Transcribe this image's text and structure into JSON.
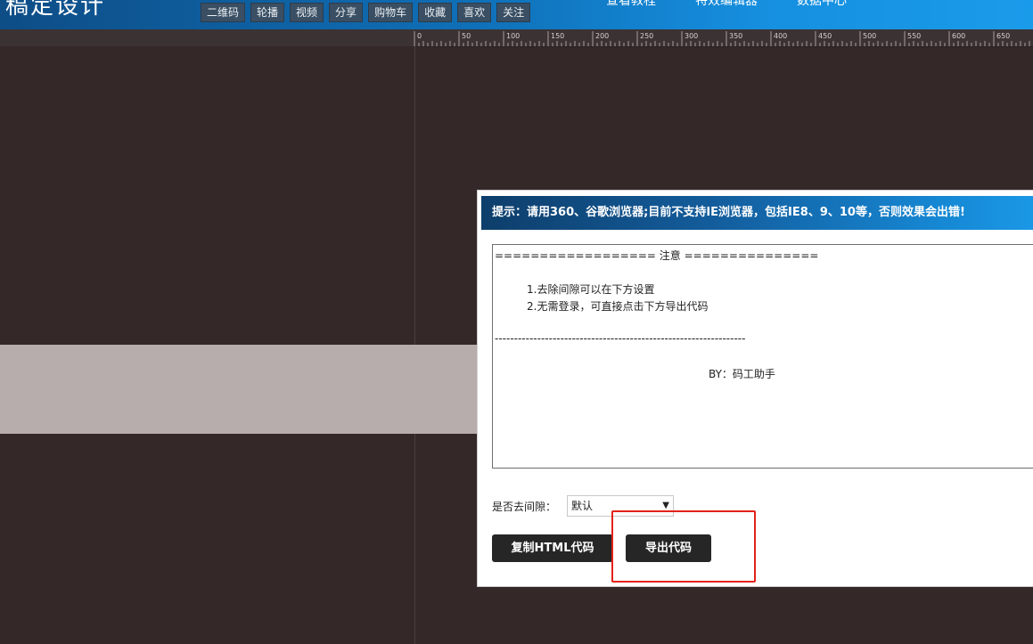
{
  "header": {
    "logo_text": "稿定设计",
    "toolbar": [
      "二维码",
      "轮播",
      "视频",
      "分享",
      "购物车",
      "收藏",
      "喜欢",
      "关注"
    ],
    "nav": [
      "查看教程",
      "特效编辑器",
      "数据中心"
    ]
  },
  "ruler": {
    "labels": [
      "0",
      "50",
      "100",
      "150",
      "200",
      "250",
      "300",
      "350",
      "400",
      "450",
      "500",
      "550",
      "600",
      "650"
    ]
  },
  "dialog": {
    "tip": "提示：请用360、谷歌浏览器;目前不支持IE浏览器，包括IE8、9、10等，否则效果会出错!",
    "notice": {
      "header": "==================  注意  ===============",
      "line1": "1.去除间隙可以在下方设置",
      "line2": "2.无需登录，可直接点击下方导出代码",
      "divider": "-----------------------------------------------------------------",
      "by": "BY：码工助手"
    },
    "gap_label": "是否去间隙：",
    "gap_value": "默认",
    "copy_button": "复制HTML代码",
    "export_button": "导出代码"
  },
  "colors": {
    "canvas": "#342829",
    "band": "#b7adad",
    "highlight": "#e2231a",
    "button": "#262626"
  }
}
